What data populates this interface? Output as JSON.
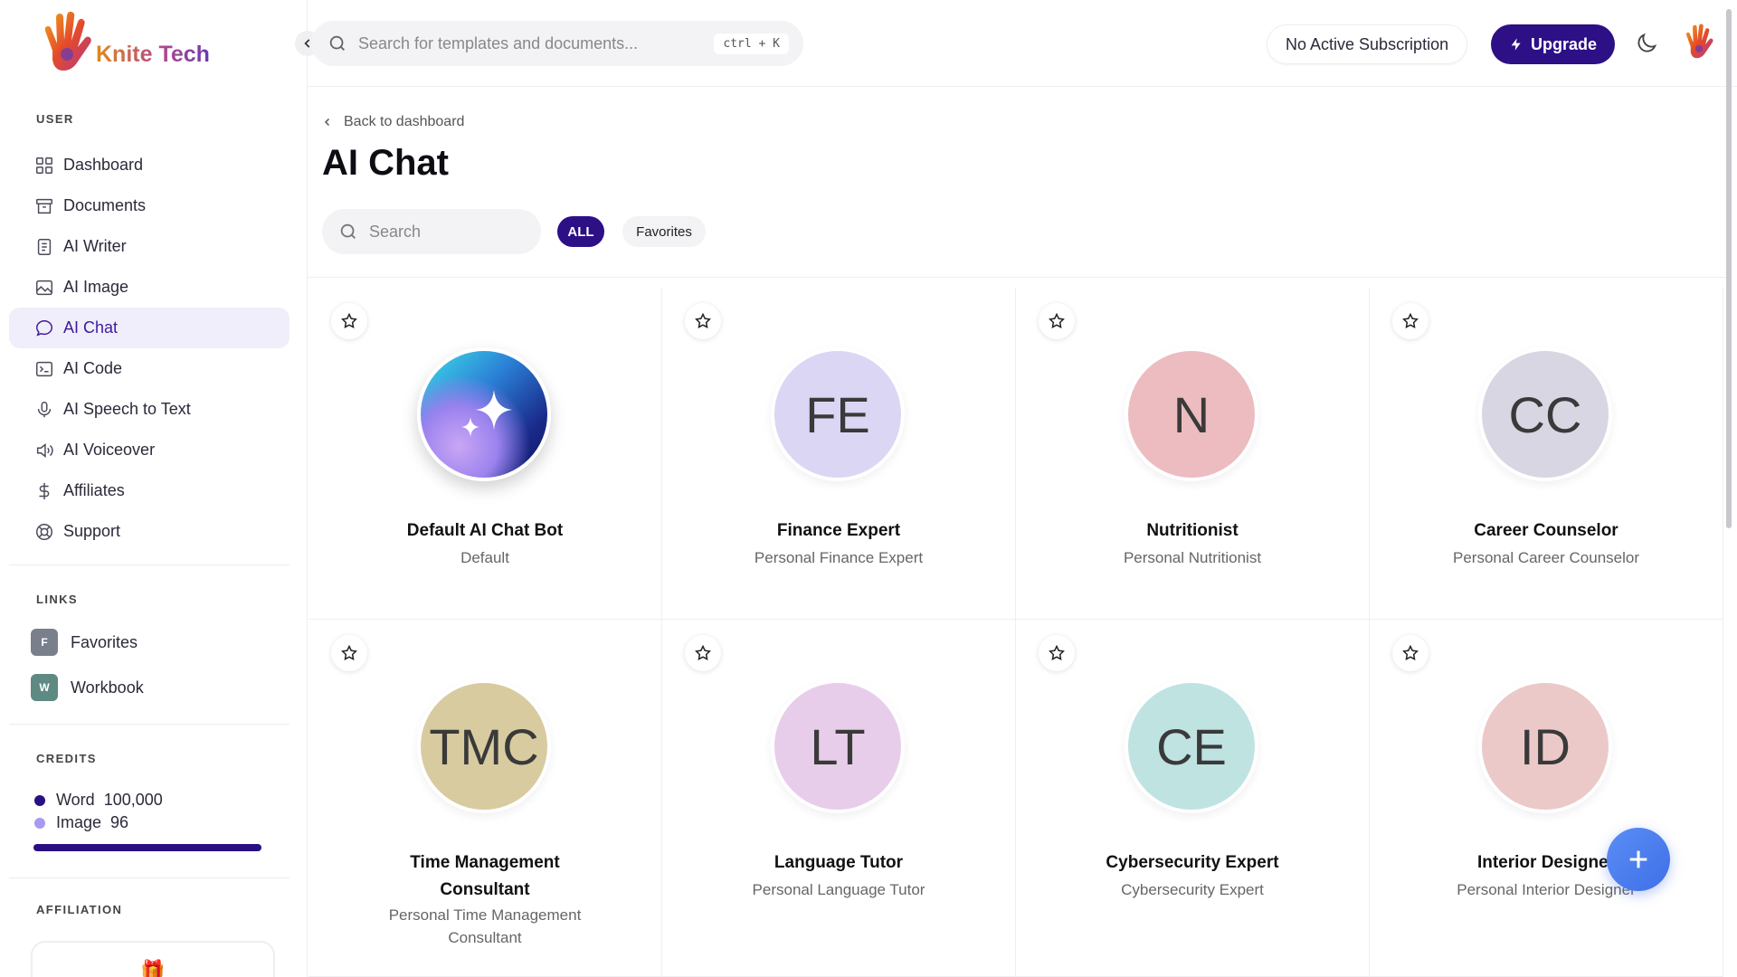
{
  "app": {
    "name": "Knite Tech"
  },
  "sidebar": {
    "user_title": "USER",
    "items": [
      {
        "label": "Dashboard",
        "icon": "grid-icon"
      },
      {
        "label": "Documents",
        "icon": "archive-icon"
      },
      {
        "label": "AI Writer",
        "icon": "file-text-icon"
      },
      {
        "label": "AI Image",
        "icon": "image-icon"
      },
      {
        "label": "AI Chat",
        "icon": "chat-icon",
        "active": true
      },
      {
        "label": "AI Code",
        "icon": "terminal-icon"
      },
      {
        "label": "AI Speech to Text",
        "icon": "microphone-icon"
      },
      {
        "label": "AI Voiceover",
        "icon": "speaker-icon"
      },
      {
        "label": "Affiliates",
        "icon": "dollar-icon"
      },
      {
        "label": "Support",
        "icon": "lifebuoy-icon"
      }
    ],
    "links_title": "LINKS",
    "links": [
      {
        "badge": "F",
        "label": "Favorites",
        "color": "#7a7f8c"
      },
      {
        "badge": "W",
        "label": "Workbook",
        "color": "#5f8a84"
      }
    ],
    "credits_title": "CREDITS",
    "credits": [
      {
        "label": "Word",
        "value": "100,000",
        "color": "#2a0f82"
      },
      {
        "label": "Image",
        "value": "96",
        "color": "#a99af0"
      }
    ],
    "affiliation_title": "AFFILIATION",
    "affiliation_icon": "gift-icon"
  },
  "topbar": {
    "search_placeholder": "Search for templates and documents...",
    "search_shortcut": "ctrl + K",
    "subscription": "No Active Subscription",
    "upgrade": "Upgrade"
  },
  "main": {
    "back": "Back to dashboard",
    "title": "AI Chat",
    "search_placeholder": "Search",
    "filters": [
      "ALL",
      "Favorites"
    ]
  },
  "accent": "#2d0f86",
  "cards": [
    {
      "initials": "",
      "name": "Default AI Chat Bot",
      "desc": "Default",
      "bg": "gradient"
    },
    {
      "initials": "FE",
      "name": "Finance Expert",
      "desc": "Personal Finance Expert",
      "bg": "#dcd6f5"
    },
    {
      "initials": "N",
      "name": "Nutritionist",
      "desc": "Personal Nutritionist",
      "bg": "#ecbcc0"
    },
    {
      "initials": "CC",
      "name": "Career Counselor",
      "desc": "Personal Career Counselor",
      "bg": "#d8d6e2"
    },
    {
      "initials": "TMC",
      "name": "Time Management Consultant",
      "desc": "Personal Time Management Consultant",
      "bg": "#d8cba0"
    },
    {
      "initials": "LT",
      "name": "Language Tutor",
      "desc": "Personal Language Tutor",
      "bg": "#e8cdea"
    },
    {
      "initials": "CE",
      "name": "Cybersecurity Expert",
      "desc": "Cybersecurity Expert",
      "bg": "#bfe3e1"
    },
    {
      "initials": "ID",
      "name": "Interior Designer",
      "desc": "Personal Interior Designer",
      "bg": "#ecc9c9"
    }
  ]
}
